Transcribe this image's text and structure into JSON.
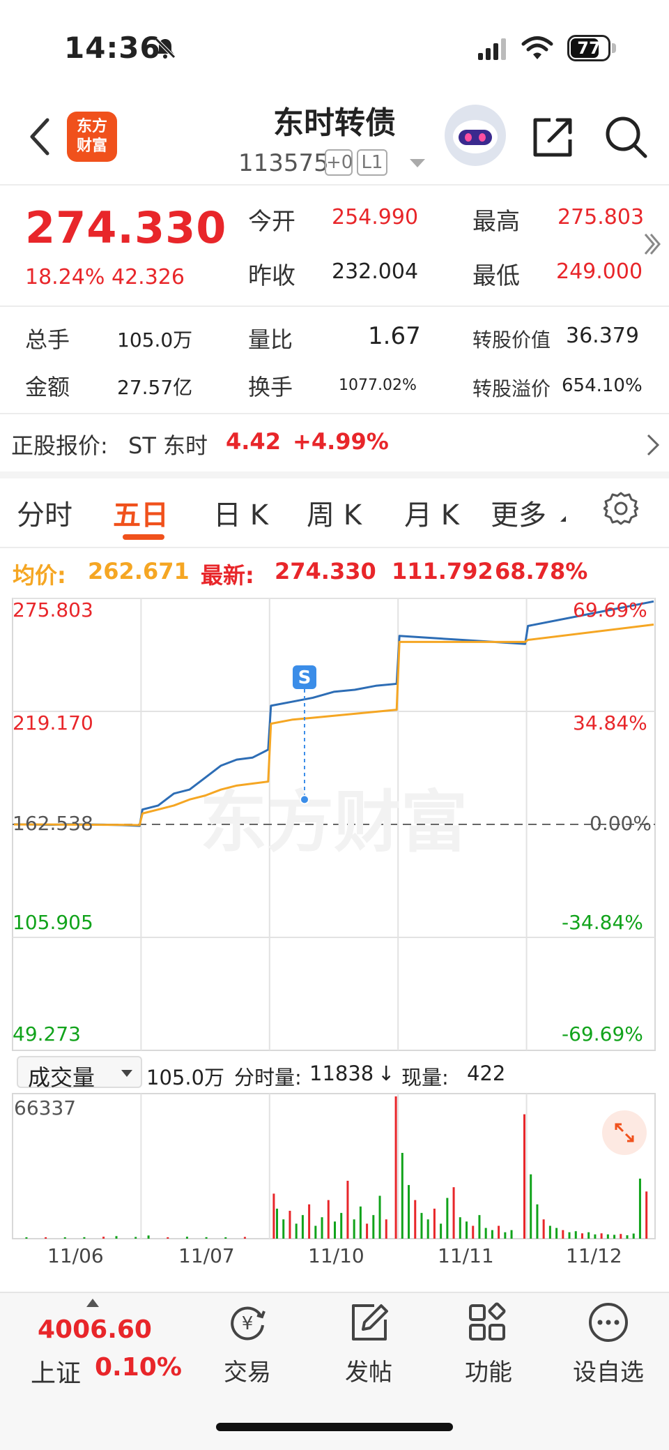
{
  "status_bar": {
    "time": "14:36",
    "battery": "77"
  },
  "header": {
    "logo_line1": "东方",
    "logo_line2": "财富",
    "stock_name": "东时转债",
    "stock_code": "113575",
    "badge_plus": "+0",
    "badge_level": "L1"
  },
  "quote": {
    "price": "274.330",
    "change_pct": "18.24%",
    "change_amt": "42.326",
    "open_label": "今开",
    "open": "254.990",
    "high_label": "最高",
    "high": "275.803",
    "prev_close_label": "昨收",
    "prev_close": "232.004",
    "low_label": "最低",
    "low": "249.000"
  },
  "stats": {
    "volume_label": "总手",
    "volume": "105.0万",
    "volume_ratio_label": "量比",
    "volume_ratio": "1.67",
    "conv_value_label": "转股价值",
    "conv_value": "36.379",
    "amount_label": "金额",
    "amount": "27.57亿",
    "turnover_label": "换手",
    "turnover": "1077.02%",
    "conv_premium_label": "转股溢价",
    "conv_premium": "654.10%"
  },
  "underlying": {
    "label": "正股报价:",
    "name": "ST 东时",
    "price": "4.42",
    "change": "+4.99%"
  },
  "tabs": [
    "分时",
    "五日",
    "日 K",
    "周 K",
    "月 K",
    "更多"
  ],
  "active_tab": "五日",
  "avg_line": {
    "avg_label": "均价:",
    "avg_value": "262.671",
    "latest_label": "最新:",
    "latest_value": "274.330",
    "latest_change": "111.792",
    "latest_pct": "68.78%"
  },
  "chart_data": {
    "type": "line",
    "title": "",
    "y_ticks_left": [
      "275.803",
      "219.170",
      "162.538",
      "105.905",
      "49.273"
    ],
    "y_ticks_right": [
      "69.69%",
      "34.84%",
      "0.00%",
      "-34.84%",
      "-69.69%"
    ],
    "ylim": [
      49.273,
      275.803
    ],
    "base": 162.538,
    "x_categories": [
      "11/06",
      "11/07",
      "11/10",
      "11/11",
      "11/12"
    ],
    "series": [
      {
        "color": "#2d6db5",
        "values": [
          162.6,
          162.5,
          162.3,
          162.6,
          162.5,
          162.4,
          162.2,
          161.8,
          170,
          172,
          178,
          180,
          186,
          192,
          195,
          196,
          200,
          222,
          224,
          226,
          229,
          230,
          232,
          233,
          257,
          256,
          255,
          254,
          253,
          262,
          274.3
        ]
      },
      {
        "color": "#f5a623",
        "values": [
          162.5,
          162.5,
          162.5,
          162.4,
          162.4,
          162.3,
          162.3,
          162.2,
          168,
          170,
          172,
          175,
          177,
          180,
          182,
          183,
          184,
          213,
          215,
          216,
          217,
          218,
          219,
          220,
          254,
          254,
          254,
          254,
          254,
          255,
          262.7
        ]
      }
    ],
    "marker_label": "S",
    "watermark": "东方财富"
  },
  "volume_panel": {
    "selector": "成交量",
    "total": "105.0万",
    "tick_label": "分时量:",
    "tick_value": "11838",
    "arrow": "↓",
    "now_label": "现量:",
    "now_value": "422",
    "ymax": "66337"
  },
  "volume_data": {
    "ymax": 66337,
    "bars": [
      {
        "x": 0.02,
        "v": 600,
        "c": "g"
      },
      {
        "x": 0.05,
        "v": 500,
        "c": "r"
      },
      {
        "x": 0.08,
        "v": 400,
        "c": "g"
      },
      {
        "x": 0.11,
        "v": 700,
        "c": "g"
      },
      {
        "x": 0.14,
        "v": 900,
        "c": "r"
      },
      {
        "x": 0.16,
        "v": 1200,
        "c": "g"
      },
      {
        "x": 0.19,
        "v": 800,
        "c": "g"
      },
      {
        "x": 0.21,
        "v": 1500,
        "c": "g"
      },
      {
        "x": 0.24,
        "v": 600,
        "c": "r"
      },
      {
        "x": 0.27,
        "v": 900,
        "c": "g"
      },
      {
        "x": 0.3,
        "v": 700,
        "c": "g"
      },
      {
        "x": 0.33,
        "v": 500,
        "c": "g"
      },
      {
        "x": 0.36,
        "v": 800,
        "c": "r"
      },
      {
        "x": 0.405,
        "v": 21000,
        "c": "r"
      },
      {
        "x": 0.41,
        "v": 14000,
        "c": "g"
      },
      {
        "x": 0.42,
        "v": 9000,
        "c": "g"
      },
      {
        "x": 0.43,
        "v": 13000,
        "c": "r"
      },
      {
        "x": 0.44,
        "v": 7000,
        "c": "g"
      },
      {
        "x": 0.45,
        "v": 11000,
        "c": "g"
      },
      {
        "x": 0.46,
        "v": 16000,
        "c": "r"
      },
      {
        "x": 0.47,
        "v": 6000,
        "c": "g"
      },
      {
        "x": 0.48,
        "v": 10000,
        "c": "g"
      },
      {
        "x": 0.49,
        "v": 18000,
        "c": "r"
      },
      {
        "x": 0.5,
        "v": 8000,
        "c": "g"
      },
      {
        "x": 0.51,
        "v": 12000,
        "c": "g"
      },
      {
        "x": 0.52,
        "v": 27000,
        "c": "r"
      },
      {
        "x": 0.53,
        "v": 9000,
        "c": "g"
      },
      {
        "x": 0.54,
        "v": 15000,
        "c": "g"
      },
      {
        "x": 0.55,
        "v": 7000,
        "c": "r"
      },
      {
        "x": 0.56,
        "v": 11000,
        "c": "g"
      },
      {
        "x": 0.57,
        "v": 20000,
        "c": "g"
      },
      {
        "x": 0.58,
        "v": 9000,
        "c": "r"
      },
      {
        "x": 0.595,
        "v": 66337,
        "c": "r"
      },
      {
        "x": 0.605,
        "v": 40000,
        "c": "g"
      },
      {
        "x": 0.615,
        "v": 25000,
        "c": "g"
      },
      {
        "x": 0.625,
        "v": 18000,
        "c": "r"
      },
      {
        "x": 0.635,
        "v": 12000,
        "c": "g"
      },
      {
        "x": 0.645,
        "v": 9000,
        "c": "g"
      },
      {
        "x": 0.655,
        "v": 14000,
        "c": "r"
      },
      {
        "x": 0.665,
        "v": 7000,
        "c": "g"
      },
      {
        "x": 0.675,
        "v": 19000,
        "c": "g"
      },
      {
        "x": 0.685,
        "v": 24000,
        "c": "r"
      },
      {
        "x": 0.695,
        "v": 10000,
        "c": "g"
      },
      {
        "x": 0.705,
        "v": 8000,
        "c": "g"
      },
      {
        "x": 0.715,
        "v": 6000,
        "c": "r"
      },
      {
        "x": 0.725,
        "v": 11000,
        "c": "g"
      },
      {
        "x": 0.735,
        "v": 5000,
        "c": "g"
      },
      {
        "x": 0.745,
        "v": 4000,
        "c": "g"
      },
      {
        "x": 0.755,
        "v": 6000,
        "c": "r"
      },
      {
        "x": 0.765,
        "v": 3000,
        "c": "g"
      },
      {
        "x": 0.775,
        "v": 4000,
        "c": "g"
      },
      {
        "x": 0.795,
        "v": 58000,
        "c": "r"
      },
      {
        "x": 0.805,
        "v": 30000,
        "c": "g"
      },
      {
        "x": 0.815,
        "v": 16000,
        "c": "g"
      },
      {
        "x": 0.825,
        "v": 9000,
        "c": "r"
      },
      {
        "x": 0.835,
        "v": 6000,
        "c": "g"
      },
      {
        "x": 0.845,
        "v": 5000,
        "c": "g"
      },
      {
        "x": 0.855,
        "v": 4000,
        "c": "r"
      },
      {
        "x": 0.865,
        "v": 3000,
        "c": "g"
      },
      {
        "x": 0.875,
        "v": 3500,
        "c": "g"
      },
      {
        "x": 0.885,
        "v": 2500,
        "c": "r"
      },
      {
        "x": 0.895,
        "v": 3000,
        "c": "g"
      },
      {
        "x": 0.905,
        "v": 2000,
        "c": "g"
      },
      {
        "x": 0.915,
        "v": 2500,
        "c": "r"
      },
      {
        "x": 0.925,
        "v": 2000,
        "c": "g"
      },
      {
        "x": 0.935,
        "v": 1800,
        "c": "g"
      },
      {
        "x": 0.945,
        "v": 2200,
        "c": "r"
      },
      {
        "x": 0.955,
        "v": 1600,
        "c": "g"
      },
      {
        "x": 0.965,
        "v": 2400,
        "c": "g"
      },
      {
        "x": 0.975,
        "v": 28000,
        "c": "g"
      },
      {
        "x": 0.985,
        "v": 22000,
        "c": "r"
      }
    ]
  },
  "bottom_nav": {
    "index_value": "4006.60",
    "index_name": "上证",
    "index_change": "0.10%",
    "items": [
      {
        "label": "交易",
        "icon": "trade-icon"
      },
      {
        "label": "发帖",
        "icon": "post-icon"
      },
      {
        "label": "功能",
        "icon": "apps-icon"
      },
      {
        "label": "设自选",
        "icon": "add-watchlist-icon"
      }
    ]
  }
}
